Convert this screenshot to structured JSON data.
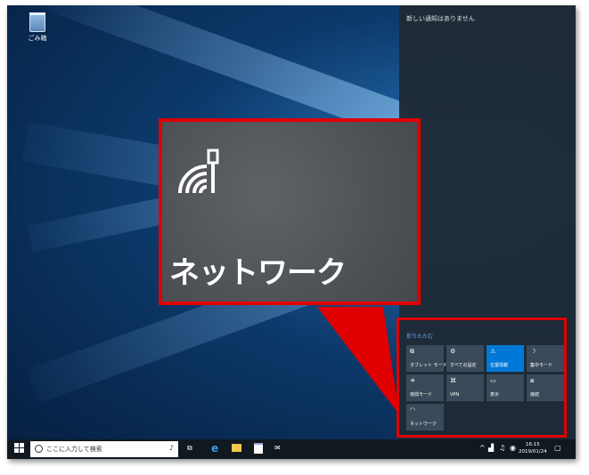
{
  "desktop": {
    "recycle_bin_label": "ごみ箱"
  },
  "action_center": {
    "header": "新しい通知はありません",
    "collapse_label": "折りたたむ",
    "tiles": [
      {
        "label": "タブレット モード",
        "icon": "tablet-mode-icon",
        "glyph": "⧉",
        "active": false
      },
      {
        "label": "すべての設定",
        "icon": "gear-icon",
        "glyph": "⚙",
        "active": false
      },
      {
        "label": "位置情報",
        "icon": "location-icon",
        "glyph": "⚠",
        "active": true
      },
      {
        "label": "集中モード",
        "icon": "moon-icon",
        "glyph": "☽",
        "active": false
      },
      {
        "label": "夜間モード",
        "icon": "night-light-icon",
        "glyph": "☀",
        "active": false
      },
      {
        "label": "VPN",
        "icon": "vpn-icon",
        "glyph": "⌘",
        "active": false
      },
      {
        "label": "表示",
        "icon": "display-icon",
        "glyph": "▭",
        "active": false
      },
      {
        "label": "接続",
        "icon": "connect-icon",
        "glyph": "⧈",
        "active": false
      },
      {
        "label": "ネットワーク",
        "icon": "network-icon",
        "glyph": "◠",
        "active": false
      }
    ]
  },
  "zoom_callout": {
    "label": "ネットワーク"
  },
  "taskbar": {
    "search_placeholder": "ここに入力して検索",
    "clock_time": "16:15",
    "clock_date": "2019/01/24"
  },
  "colors": {
    "highlight": "#e00000",
    "tile_active": "#0078d7",
    "tile": "#3a4a5a"
  }
}
